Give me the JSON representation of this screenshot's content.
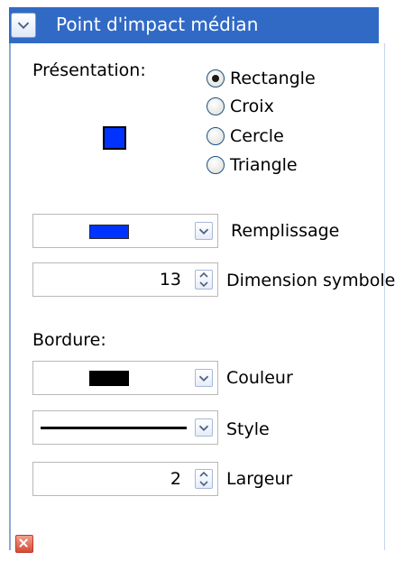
{
  "panel": {
    "title": "Point d'impact médian",
    "collapse_icon": "chevron-down-icon",
    "close_icon": "close-icon"
  },
  "presentation": {
    "label": "Présentation:",
    "options": [
      {
        "label": "Rectangle",
        "checked": true
      },
      {
        "label": "Croix",
        "checked": false
      },
      {
        "label": "Cercle",
        "checked": false
      },
      {
        "label": "Triangle",
        "checked": false
      }
    ],
    "preview_color": "#0033ff"
  },
  "fill": {
    "label": "Remplissage",
    "color": "#0033ff"
  },
  "symbol_size": {
    "label": "Dimension symbole",
    "value": "13"
  },
  "border": {
    "label": "Bordure:",
    "color": {
      "label": "Couleur",
      "value": "#000000"
    },
    "style": {
      "label": "Style",
      "value": "solid"
    },
    "width": {
      "label": "Largeur",
      "value": "2"
    }
  },
  "colors": {
    "title_bar": "#316ac5",
    "accent_blue": "#0033ff",
    "close_red": "#d64a35"
  }
}
